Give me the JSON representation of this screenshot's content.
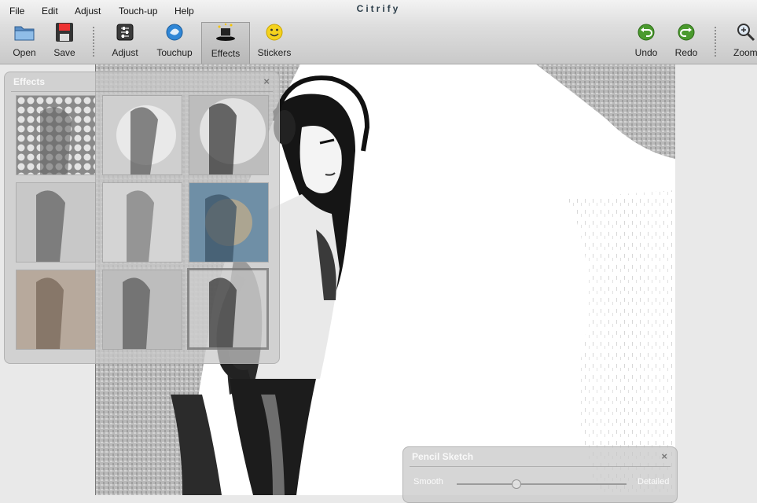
{
  "app": {
    "title": "Citrify"
  },
  "menu": {
    "items": [
      {
        "label": "File"
      },
      {
        "label": "Edit"
      },
      {
        "label": "Adjust"
      },
      {
        "label": "Touch-up"
      },
      {
        "label": "Help"
      }
    ]
  },
  "toolbar": {
    "open": "Open",
    "save": "Save",
    "adjust": "Adjust",
    "touchup": "Touchup",
    "effects": "Effects",
    "stickers": "Stickers",
    "undo": "Undo",
    "redo": "Redo",
    "zoom": "Zoom"
  },
  "effects_panel": {
    "title": "Effects",
    "close": "×"
  },
  "sketch_panel": {
    "title": "Pencil Sketch",
    "close": "×",
    "min_label": "Smooth",
    "max_label": "Detailed",
    "value": 0.35
  },
  "colors": {
    "accent_green": "#4a9a2e",
    "title_color": "#2c3e4a"
  }
}
